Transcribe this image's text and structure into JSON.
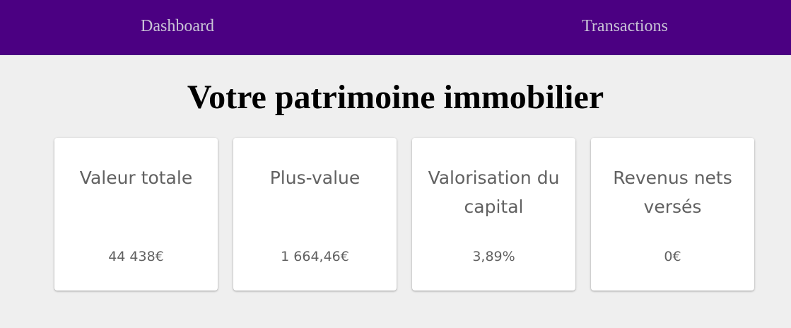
{
  "nav": {
    "dashboard_label": "Dashboard",
    "transactions_label": "Transactions"
  },
  "page": {
    "title": "Votre patrimoine immobilier"
  },
  "cards": [
    {
      "label": "Valeur totale",
      "value": "44 438€"
    },
    {
      "label": "Plus-value",
      "value": "1 664,46€"
    },
    {
      "label": "Valorisation du capital",
      "value": "3,89%"
    },
    {
      "label": "Revenus nets versés",
      "value": "0€"
    }
  ],
  "colors": {
    "navbar": "#4b0082",
    "background": "#efefef",
    "card": "#ffffff",
    "card_text": "#616161",
    "nav_text": "#c9c3d6"
  }
}
